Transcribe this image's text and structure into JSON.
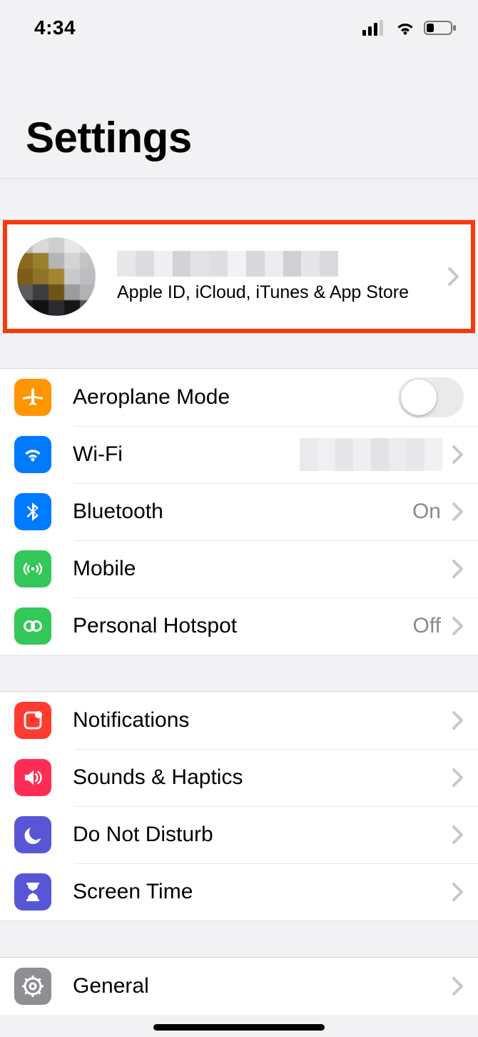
{
  "status": {
    "time": "4:34"
  },
  "title": "Settings",
  "appleId": {
    "subtitle": "Apple ID, iCloud, iTunes & App Store"
  },
  "group1": {
    "aeroplane": {
      "label": "Aeroplane Mode"
    },
    "wifi": {
      "label": "Wi-Fi"
    },
    "bluetooth": {
      "label": "Bluetooth",
      "value": "On"
    },
    "mobile": {
      "label": "Mobile"
    },
    "hotspot": {
      "label": "Personal Hotspot",
      "value": "Off"
    }
  },
  "group2": {
    "notifications": {
      "label": "Notifications"
    },
    "sounds": {
      "label": "Sounds & Haptics"
    },
    "dnd": {
      "label": "Do Not Disturb"
    },
    "screentime": {
      "label": "Screen Time"
    }
  },
  "group3": {
    "general": {
      "label": "General"
    }
  }
}
